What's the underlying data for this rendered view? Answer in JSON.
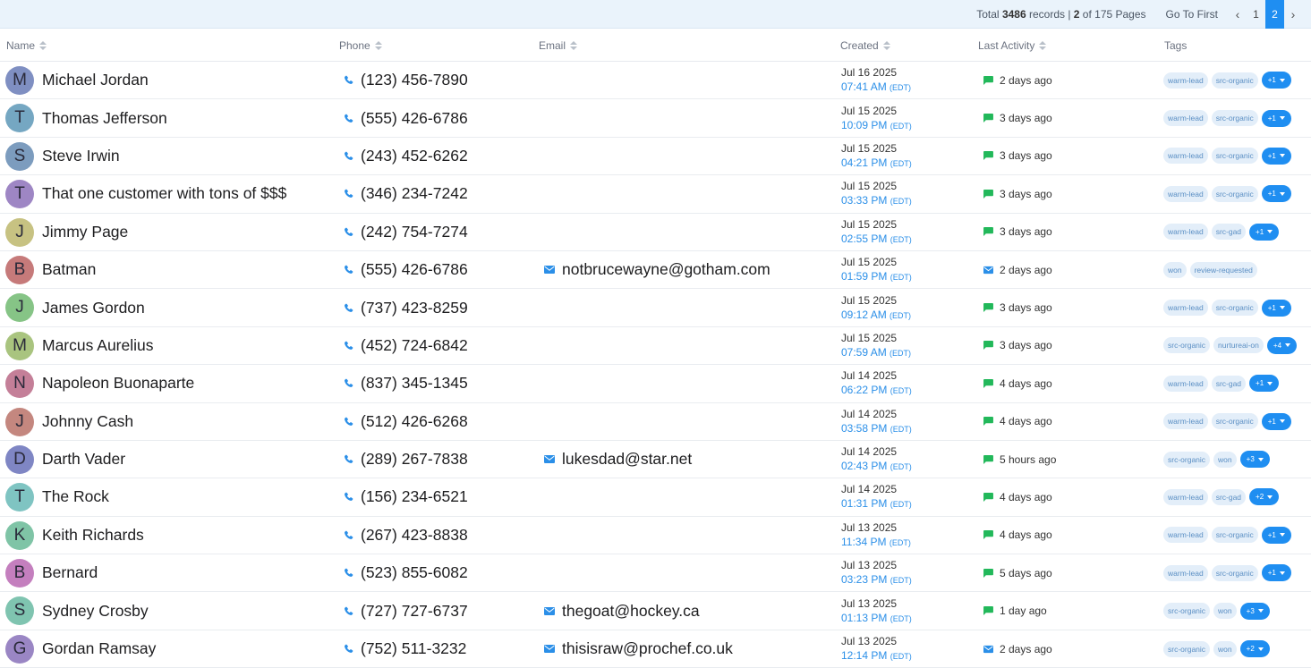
{
  "pager": {
    "total_prefix": "Total ",
    "total_count": "3486",
    "total_mid": " records | ",
    "current_page": "2",
    "page_mid": " of 175 Pages",
    "go_first": "Go To First",
    "prev_icon": "‹",
    "next_icon": "›",
    "pages": [
      "1",
      "2"
    ]
  },
  "columns": {
    "name": "Name",
    "phone": "Phone",
    "email": "Email",
    "created": "Created",
    "last_activity": "Last Activity",
    "tags": "Tags"
  },
  "rows": [
    {
      "initial": "M",
      "color": "#7f8fc2",
      "name": "Michael Jordan",
      "phone": "(123) 456-7890",
      "email": "",
      "date": "Jul 16 2025",
      "time": "07:41 AM",
      "tz": "(EDT)",
      "activity": "2 days ago",
      "activity_icon": "message-icon",
      "tags": [
        "warm-lead",
        "src-organic"
      ],
      "more": "+1"
    },
    {
      "initial": "T",
      "color": "#75a7c2",
      "name": "Thomas Jefferson",
      "phone": "(555) 426-6786",
      "email": "",
      "date": "Jul 15 2025",
      "time": "10:09 PM",
      "tz": "(EDT)",
      "activity": "3 days ago",
      "activity_icon": "message-icon",
      "tags": [
        "warm-lead",
        "src-organic"
      ],
      "more": "+1"
    },
    {
      "initial": "S",
      "color": "#7c9cbe",
      "name": "Steve Irwin",
      "phone": "(243) 452-6262",
      "email": "",
      "date": "Jul 15 2025",
      "time": "04:21 PM",
      "tz": "(EDT)",
      "activity": "3 days ago",
      "activity_icon": "message-icon",
      "tags": [
        "warm-lead",
        "src-organic"
      ],
      "more": "+1"
    },
    {
      "initial": "T",
      "color": "#9e86c4",
      "name": "That one customer with tons of $$$",
      "phone": "(346) 234-7242",
      "email": "",
      "date": "Jul 15 2025",
      "time": "03:33 PM",
      "tz": "(EDT)",
      "activity": "3 days ago",
      "activity_icon": "message-icon",
      "tags": [
        "warm-lead",
        "src-organic"
      ],
      "more": "+1"
    },
    {
      "initial": "J",
      "color": "#c7c282",
      "name": "Jimmy Page",
      "phone": "(242) 754-7274",
      "email": "",
      "date": "Jul 15 2025",
      "time": "02:55 PM",
      "tz": "(EDT)",
      "activity": "3 days ago",
      "activity_icon": "message-icon",
      "tags": [
        "warm-lead",
        "src-gad"
      ],
      "more": "+1"
    },
    {
      "initial": "B",
      "color": "#c67a7a",
      "name": "Batman",
      "phone": "(555) 426-6786",
      "email": "notbrucewayne@gotham.com",
      "date": "Jul 15 2025",
      "time": "01:59 PM",
      "tz": "(EDT)",
      "activity": "2 days ago",
      "activity_icon": "mail-icon",
      "tags": [
        "won",
        "review-requested"
      ],
      "more": ""
    },
    {
      "initial": "J",
      "color": "#86c486",
      "name": "James Gordon",
      "phone": "(737) 423-8259",
      "email": "",
      "date": "Jul 15 2025",
      "time": "09:12 AM",
      "tz": "(EDT)",
      "activity": "3 days ago",
      "activity_icon": "message-icon",
      "tags": [
        "warm-lead",
        "src-organic"
      ],
      "more": "+1"
    },
    {
      "initial": "M",
      "color": "#a9c47f",
      "name": "Marcus Aurelius",
      "phone": "(452) 724-6842",
      "email": "",
      "date": "Jul 15 2025",
      "time": "07:59 AM",
      "tz": "(EDT)",
      "activity": "3 days ago",
      "activity_icon": "message-icon",
      "tags": [
        "src-organic",
        "nurtureai-on"
      ],
      "more": "+4"
    },
    {
      "initial": "N",
      "color": "#c47f98",
      "name": "Napoleon Buonaparte",
      "phone": "(837) 345-1345",
      "email": "",
      "date": "Jul 14 2025",
      "time": "06:22 PM",
      "tz": "(EDT)",
      "activity": "4 days ago",
      "activity_icon": "message-icon",
      "tags": [
        "warm-lead",
        "src-gad"
      ],
      "more": "+1"
    },
    {
      "initial": "J",
      "color": "#c4877f",
      "name": "Johnny Cash",
      "phone": "(512) 426-6268",
      "email": "",
      "date": "Jul 14 2025",
      "time": "03:58 PM",
      "tz": "(EDT)",
      "activity": "4 days ago",
      "activity_icon": "message-icon",
      "tags": [
        "warm-lead",
        "src-organic"
      ],
      "more": "+1"
    },
    {
      "initial": "D",
      "color": "#7f86c4",
      "name": "Darth Vader",
      "phone": "(289) 267-7838",
      "email": "lukesdad@star.net",
      "date": "Jul 14 2025",
      "time": "02:43 PM",
      "tz": "(EDT)",
      "activity": "5 hours ago",
      "activity_icon": "message-icon",
      "tags": [
        "src-organic",
        "won"
      ],
      "more": "+3"
    },
    {
      "initial": "T",
      "color": "#7fc4c2",
      "name": "The Rock",
      "phone": "(156) 234-6521",
      "email": "",
      "date": "Jul 14 2025",
      "time": "01:31 PM",
      "tz": "(EDT)",
      "activity": "4 days ago",
      "activity_icon": "message-icon",
      "tags": [
        "warm-lead",
        "src-gad"
      ],
      "more": "+2"
    },
    {
      "initial": "K",
      "color": "#7fc4a6",
      "name": "Keith Richards",
      "phone": "(267) 423-8838",
      "email": "",
      "date": "Jul 13 2025",
      "time": "11:34 PM",
      "tz": "(EDT)",
      "activity": "4 days ago",
      "activity_icon": "message-icon",
      "tags": [
        "warm-lead",
        "src-organic"
      ],
      "more": "+1"
    },
    {
      "initial": "B",
      "color": "#c47fbe",
      "name": "Bernard",
      "phone": "(523) 855-6082",
      "email": "",
      "date": "Jul 13 2025",
      "time": "03:23 PM",
      "tz": "(EDT)",
      "activity": "5 days ago",
      "activity_icon": "message-icon",
      "tags": [
        "warm-lead",
        "src-organic"
      ],
      "more": "+1"
    },
    {
      "initial": "S",
      "color": "#7fc4b0",
      "name": "Sydney Crosby",
      "phone": "(727) 727-6737",
      "email": "thegoat@hockey.ca",
      "date": "Jul 13 2025",
      "time": "01:13 PM",
      "tz": "(EDT)",
      "activity": "1 day ago",
      "activity_icon": "message-icon",
      "tags": [
        "src-organic",
        "won"
      ],
      "more": "+3"
    },
    {
      "initial": "G",
      "color": "#9a86c4",
      "name": "Gordan Ramsay",
      "phone": "(752) 511-3232",
      "email": "thisisraw@prochef.co.uk",
      "date": "Jul 13 2025",
      "time": "12:14 PM",
      "tz": "(EDT)",
      "activity": "2 days ago",
      "activity_icon": "mail-icon",
      "tags": [
        "src-organic",
        "won"
      ],
      "more": "+2"
    }
  ]
}
